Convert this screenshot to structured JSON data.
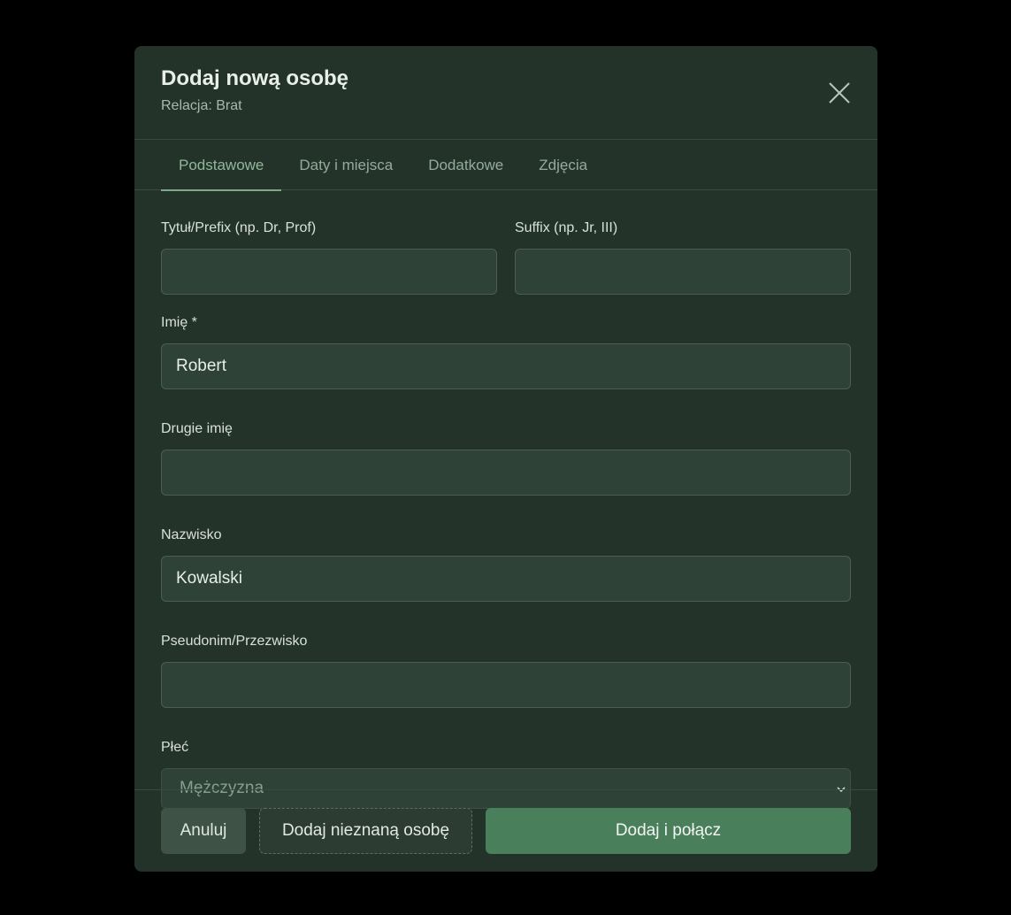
{
  "modal": {
    "title": "Dodaj nową osobę",
    "subtitle": "Relacja: Brat"
  },
  "tabs": [
    {
      "label": "Podstawowe",
      "active": true
    },
    {
      "label": "Daty i miejsca",
      "active": false
    },
    {
      "label": "Dodatkowe",
      "active": false
    },
    {
      "label": "Zdjęcia",
      "active": false
    }
  ],
  "form": {
    "prefix": {
      "label": "Tytuł/Prefix (np. Dr, Prof)",
      "value": ""
    },
    "suffix": {
      "label": "Suffix (np. Jr, III)",
      "value": ""
    },
    "first_name": {
      "label": "Imię *",
      "value": "Robert"
    },
    "middle_name": {
      "label": "Drugie imię",
      "value": ""
    },
    "last_name": {
      "label": "Nazwisko",
      "value": "Kowalski"
    },
    "nickname": {
      "label": "Pseudonim/Przezwisko",
      "value": ""
    },
    "gender": {
      "label": "Płeć",
      "selected": "Mężczyzna"
    }
  },
  "footer": {
    "cancel_label": "Anuluj",
    "unknown_label": "Dodaj nieznaną osobę",
    "submit_label": "Dodaj i połącz"
  },
  "colors": {
    "background": "#000000",
    "modal_bg": "#24332a",
    "accent": "#4a7f5c",
    "input_bg": "#2f4237"
  },
  "icons": {
    "close": "close-icon",
    "select": "chevron-down-icon"
  }
}
